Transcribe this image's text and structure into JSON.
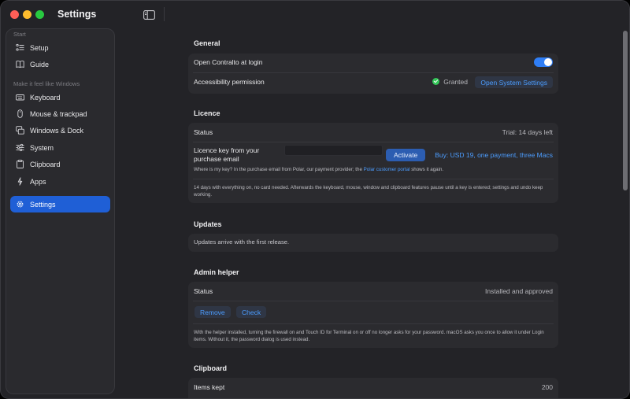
{
  "window": {
    "title": "Settings"
  },
  "colors": {
    "accent": "#1f5fd6",
    "link": "#4c9dff",
    "success": "#34c759",
    "toggle_on": "#2f7ef6"
  },
  "sidebar": {
    "sections": [
      {
        "label": "Start",
        "items": [
          {
            "label": "Setup",
            "icon": "checklist-icon"
          },
          {
            "label": "Guide",
            "icon": "book-icon"
          }
        ]
      },
      {
        "label": "Make it feel like Windows",
        "items": [
          {
            "label": "Keyboard",
            "icon": "keyboard-icon"
          },
          {
            "label": "Mouse & trackpad",
            "icon": "mouse-icon"
          },
          {
            "label": "Windows & Dock",
            "icon": "windows-icon"
          },
          {
            "label": "System",
            "icon": "sliders-icon"
          },
          {
            "label": "Clipboard",
            "icon": "clipboard-icon"
          },
          {
            "label": "Apps",
            "icon": "apps-icon"
          }
        ]
      },
      {
        "label": "",
        "items": [
          {
            "label": "Settings",
            "icon": "gear-icon",
            "active": true
          }
        ]
      }
    ]
  },
  "general": {
    "title": "General",
    "open_at_login_label": "Open Contralto at login",
    "open_at_login_on": true,
    "accessibility_label": "Accessibility permission",
    "accessibility_status": "Granted",
    "open_system_settings": "Open System Settings"
  },
  "licence": {
    "title": "Licence",
    "status_label": "Status",
    "status_value": "Trial: 14 days left",
    "key_label": "Licence key from your purchase email",
    "key_value": "",
    "activate": "Activate",
    "buy": "Buy: USD 19, one payment, three Macs",
    "where_text_pre": "Where is my key? In the purchase email from Polar, our payment provider; the",
    "where_link": "Polar customer portal",
    "where_text_post": "shows it again.",
    "trial_note": "14 days with everything on, no card needed. Afterwards the keyboard, mouse, window and clipboard features pause until a key is entered; settings and undo keep working."
  },
  "updates": {
    "title": "Updates",
    "note": "Updates arrive with the first release."
  },
  "admin_helper": {
    "title": "Admin helper",
    "status_label": "Status",
    "status_value": "Installed and approved",
    "remove": "Remove",
    "check": "Check",
    "note": "With the helper installed, turning the firewall on and Touch ID for Terminal on or off no longer asks for your password. macOS asks you once to allow it under Login items. Without it, the password dialog is used instead."
  },
  "clipboard": {
    "title": "Clipboard",
    "items_kept_label": "Items kept",
    "items_kept_value": "200"
  }
}
